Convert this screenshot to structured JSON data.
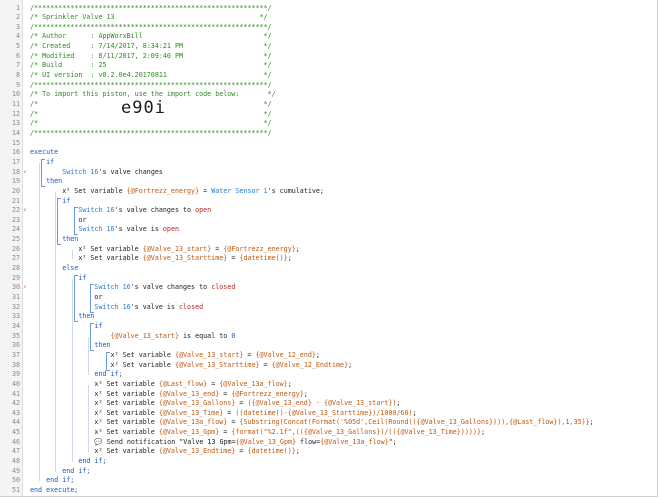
{
  "editor": {
    "import_code": "e90i",
    "lines": [
      {
        "n": "1",
        "code": [
          {
            "t": "/**********************************************************/",
            "c": "comment"
          }
        ]
      },
      {
        "n": "2",
        "code": [
          {
            "t": "/* Sprinkler Valve 13                                    */",
            "c": "comment"
          }
        ]
      },
      {
        "n": "3",
        "code": [
          {
            "t": "/**********************************************************/",
            "c": "comment"
          }
        ]
      },
      {
        "n": "4",
        "code": [
          {
            "t": "/* Author      : AppWorxBill                              */",
            "c": "comment"
          }
        ]
      },
      {
        "n": "5",
        "code": [
          {
            "t": "/* Created     : 7/14/2017, 8:34:21 PM                    */",
            "c": "comment"
          }
        ]
      },
      {
        "n": "6",
        "code": [
          {
            "t": "/* Modified    : 8/11/2017, 2:09:40 PM                    */",
            "c": "comment"
          }
        ]
      },
      {
        "n": "7",
        "code": [
          {
            "t": "/* Build       : 25                                       */",
            "c": "comment"
          }
        ]
      },
      {
        "n": "8",
        "code": [
          {
            "t": "/* UI version  : v0.2.0e4.20170811                        */",
            "c": "comment"
          }
        ]
      },
      {
        "n": "9",
        "code": [
          {
            "t": "/**********************************************************/",
            "c": "comment"
          }
        ]
      },
      {
        "n": "10",
        "code": [
          {
            "t": "/* To import this piston, use the import code below:       */",
            "c": "comment"
          }
        ]
      },
      {
        "n": "11",
        "code": [
          {
            "t": "/*                                                        */",
            "c": "comment"
          }
        ]
      },
      {
        "n": "12",
        "code": [
          {
            "t": "/*                                                        */",
            "c": "comment"
          }
        ]
      },
      {
        "n": "13",
        "code": [
          {
            "t": "/*                                                        */",
            "c": "comment"
          }
        ]
      },
      {
        "n": "14",
        "code": [
          {
            "t": "/**********************************************************/",
            "c": "comment"
          }
        ]
      },
      {
        "n": "15",
        "code": []
      },
      {
        "n": "16",
        "code": [
          {
            "t": "execute",
            "c": "kw"
          }
        ]
      },
      {
        "n": "17",
        "code": [
          {
            "t": "    if",
            "c": "kw"
          }
        ]
      },
      {
        "n": "18",
        "mark": "⚡",
        "code": [
          {
            "t": "        Switch 16",
            "c": "dev"
          },
          {
            "t": "'s ",
            "c": "plain"
          },
          {
            "t": "valve",
            "c": "plain"
          },
          {
            "t": " changes",
            "c": "plain"
          }
        ]
      },
      {
        "n": "19",
        "code": [
          {
            "t": "    then",
            "c": "kw"
          }
        ]
      },
      {
        "n": "20",
        "code": [
          {
            "t": "        x² Set variable ",
            "c": "plain"
          },
          {
            "t": "{@Fortrezz_energy}",
            "c": "var"
          },
          {
            "t": " = ",
            "c": "plain"
          },
          {
            "t": "Water Sensor 1",
            "c": "dev"
          },
          {
            "t": "'s cumulative;",
            "c": "plain"
          }
        ]
      },
      {
        "n": "21",
        "code": [
          {
            "t": "        if",
            "c": "kw"
          }
        ]
      },
      {
        "n": "22",
        "mark": "⚡",
        "code": [
          {
            "t": "            Switch 16",
            "c": "dev"
          },
          {
            "t": "'s valve changes to ",
            "c": "plain"
          },
          {
            "t": "open",
            "c": "val"
          }
        ]
      },
      {
        "n": "23",
        "code": [
          {
            "t": "            or",
            "c": "plain"
          }
        ]
      },
      {
        "n": "24",
        "code": [
          {
            "t": "            Switch 16",
            "c": "dev"
          },
          {
            "t": "'s valve is ",
            "c": "plain"
          },
          {
            "t": "open",
            "c": "val"
          }
        ]
      },
      {
        "n": "25",
        "code": [
          {
            "t": "        then",
            "c": "kw"
          }
        ]
      },
      {
        "n": "26",
        "code": [
          {
            "t": "            x² Set variable ",
            "c": "plain"
          },
          {
            "t": "{@Valve_13_start}",
            "c": "var"
          },
          {
            "t": " = ",
            "c": "plain"
          },
          {
            "t": "{@Fortrezz_energy}",
            "c": "var"
          },
          {
            "t": ";",
            "c": "plain"
          }
        ]
      },
      {
        "n": "27",
        "code": [
          {
            "t": "            x² Set variable ",
            "c": "plain"
          },
          {
            "t": "{@Valve_13_Starttime}",
            "c": "var"
          },
          {
            "t": " = ",
            "c": "plain"
          },
          {
            "t": "{datetime()}",
            "c": "var"
          },
          {
            "t": ";",
            "c": "plain"
          }
        ]
      },
      {
        "n": "28",
        "code": [
          {
            "t": "        else",
            "c": "kw"
          }
        ]
      },
      {
        "n": "29",
        "code": [
          {
            "t": "            if",
            "c": "kw"
          }
        ]
      },
      {
        "n": "30",
        "mark": "⚡",
        "code": [
          {
            "t": "                Switch 16",
            "c": "dev"
          },
          {
            "t": "'s valve changes to ",
            "c": "plain"
          },
          {
            "t": "closed",
            "c": "val"
          }
        ]
      },
      {
        "n": "31",
        "code": [
          {
            "t": "                or",
            "c": "plain"
          }
        ]
      },
      {
        "n": "32",
        "code": [
          {
            "t": "                Switch 16",
            "c": "dev"
          },
          {
            "t": "'s valve is ",
            "c": "plain"
          },
          {
            "t": "closed",
            "c": "val"
          }
        ]
      },
      {
        "n": "33",
        "code": [
          {
            "t": "            then",
            "c": "kw"
          }
        ]
      },
      {
        "n": "34",
        "code": [
          {
            "t": "                if",
            "c": "kw"
          }
        ]
      },
      {
        "n": "35",
        "code": [
          {
            "t": "                    {@Valve_13_start}",
            "c": "var"
          },
          {
            "t": " is equal to ",
            "c": "plain"
          },
          {
            "t": "0",
            "c": "kw"
          }
        ]
      },
      {
        "n": "36",
        "code": [
          {
            "t": "                then",
            "c": "kw"
          }
        ]
      },
      {
        "n": "37",
        "code": [
          {
            "t": "                    x² Set variable ",
            "c": "plain"
          },
          {
            "t": "{@Valve_13_start}",
            "c": "var"
          },
          {
            "t": " = ",
            "c": "plain"
          },
          {
            "t": "{@Valve_12_end}",
            "c": "var"
          },
          {
            "t": ";",
            "c": "plain"
          }
        ]
      },
      {
        "n": "38",
        "code": [
          {
            "t": "                    x² Set variable ",
            "c": "plain"
          },
          {
            "t": "{@Valve_13_Starttime}",
            "c": "var"
          },
          {
            "t": " = ",
            "c": "plain"
          },
          {
            "t": "{@Valve_12_Endtime}",
            "c": "var"
          },
          {
            "t": ";",
            "c": "plain"
          }
        ]
      },
      {
        "n": "39",
        "code": [
          {
            "t": "                end if;",
            "c": "kw"
          }
        ]
      },
      {
        "n": "40",
        "code": [
          {
            "t": "                x² Set variable ",
            "c": "plain"
          },
          {
            "t": "{@Last_flow}",
            "c": "var"
          },
          {
            "t": " = ",
            "c": "plain"
          },
          {
            "t": "{@Valve_13a_flow}",
            "c": "var"
          },
          {
            "t": ";",
            "c": "plain"
          }
        ]
      },
      {
        "n": "41",
        "code": [
          {
            "t": "                x² Set variable ",
            "c": "plain"
          },
          {
            "t": "{@Valve_13_end}",
            "c": "var"
          },
          {
            "t": " = ",
            "c": "plain"
          },
          {
            "t": "{@Fortrezz_energy}",
            "c": "var"
          },
          {
            "t": ";",
            "c": "plain"
          }
        ]
      },
      {
        "n": "42",
        "code": [
          {
            "t": "                x² Set variable ",
            "c": "plain"
          },
          {
            "t": "{@Valve_13_Gallons}",
            "c": "var"
          },
          {
            "t": " = ",
            "c": "plain"
          },
          {
            "t": "({@Valve_13_end} - {@Valve_13_start})",
            "c": "var"
          },
          {
            "t": ";",
            "c": "plain"
          }
        ]
      },
      {
        "n": "43",
        "code": [
          {
            "t": "                x² Set variable ",
            "c": "plain"
          },
          {
            "t": "{@Valve_13_Time}",
            "c": "var"
          },
          {
            "t": " = ",
            "c": "plain"
          },
          {
            "t": "((datetime()-{@Valve_13_Starttime})/1000/60)",
            "c": "var"
          },
          {
            "t": ";",
            "c": "plain"
          }
        ]
      },
      {
        "n": "44",
        "code": [
          {
            "t": "                x² Set variable ",
            "c": "plain"
          },
          {
            "t": "{@Valve_13a_flow}",
            "c": "var"
          },
          {
            "t": " = ",
            "c": "plain"
          },
          {
            "t": "{Substring(Concat(Format('%05d',Ceil(Round(({@Valve_13_Gallons}))),{@Last_flow}),1,35)}",
            "c": "var"
          },
          {
            "t": ";",
            "c": "plain"
          }
        ]
      },
      {
        "n": "45",
        "code": [
          {
            "t": "                x² Set variable ",
            "c": "plain"
          },
          {
            "t": "{@Valve_13_Gpm}",
            "c": "var"
          },
          {
            "t": " = ",
            "c": "plain"
          },
          {
            "t": "{format(\"%2.1f\",(({@Valve_13_Gallons})/(({@Valve_13_Time}))))}",
            "c": "var"
          },
          {
            "t": ";",
            "c": "plain"
          }
        ]
      },
      {
        "n": "46",
        "code": [
          {
            "t": "                💬 Send notification \"Valve 13 Gpm=",
            "c": "plain"
          },
          {
            "t": "{@Valve_13_Gpm}",
            "c": "var"
          },
          {
            "t": " flow=",
            "c": "plain"
          },
          {
            "t": "{@Valve_13a_flow}",
            "c": "var"
          },
          {
            "t": "\";",
            "c": "plain"
          }
        ]
      },
      {
        "n": "47",
        "code": [
          {
            "t": "                x² Set variable ",
            "c": "plain"
          },
          {
            "t": "{@Valve_13_Endtime}",
            "c": "var"
          },
          {
            "t": " = ",
            "c": "plain"
          },
          {
            "t": "{datetime()}",
            "c": "var"
          },
          {
            "t": ";",
            "c": "plain"
          }
        ]
      },
      {
        "n": "48",
        "code": [
          {
            "t": "            end if;",
            "c": "kw"
          }
        ]
      },
      {
        "n": "49",
        "code": [
          {
            "t": "        end if;",
            "c": "kw"
          }
        ]
      },
      {
        "n": "50",
        "code": [
          {
            "t": "    end if;",
            "c": "kw"
          }
        ]
      },
      {
        "n": "51",
        "code": [
          {
            "t": "end execute;",
            "c": "kw"
          }
        ]
      }
    ]
  }
}
